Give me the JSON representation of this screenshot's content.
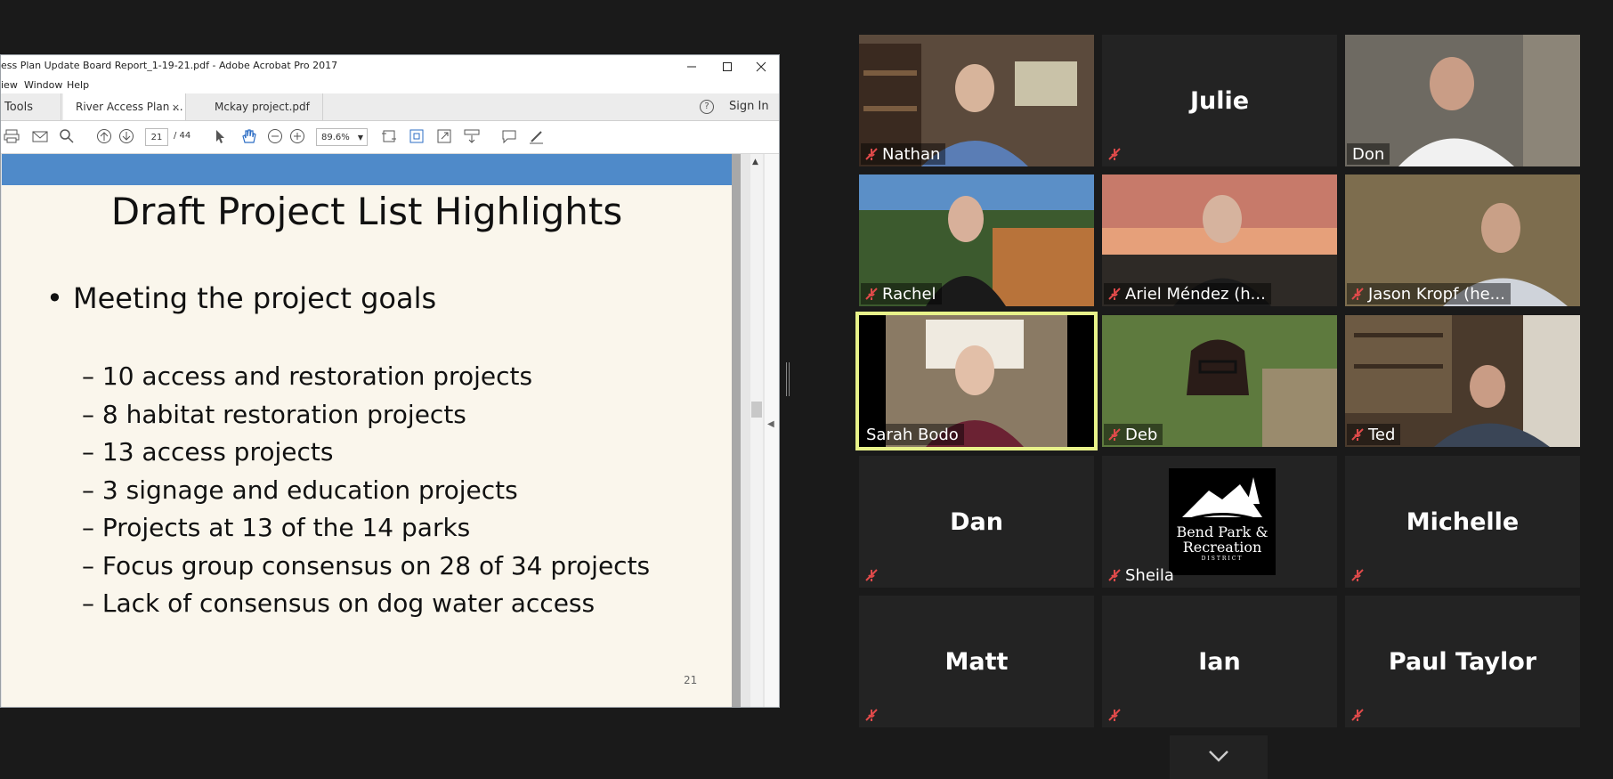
{
  "acrobat": {
    "window_title": "ess Plan Update Board Report_1-19-21.pdf - Adobe Acrobat Pro 2017",
    "menu": [
      "iew",
      "Window",
      "Help"
    ],
    "tabs": {
      "tools": "Tools",
      "active": "River Access Plan ...",
      "active_close": "×",
      "other": "Mckay project.pdf"
    },
    "signin": "Sign In",
    "help_glyph": "?",
    "page_current": "21",
    "page_total": "/ 44",
    "zoom": "89.6%"
  },
  "slide": {
    "title": "Draft Project List Highlights",
    "bullet": "Meeting the project goals",
    "subitems": [
      "– 10 access and restoration projects",
      "– 8 habitat restoration projects",
      "– 13 access projects",
      "– 3 signage and education projects",
      "– Projects at 13 of the 14 parks",
      "– Focus group consensus on 28 of 34 projects",
      "– Lack of consensus on dog water access"
    ],
    "page_number": "21"
  },
  "participants": [
    {
      "name": "Nathan",
      "muted": true,
      "video": true
    },
    {
      "name": "Julie",
      "muted": true,
      "video": false
    },
    {
      "name": "Don",
      "muted": false,
      "video": true
    },
    {
      "name": "Rachel",
      "muted": true,
      "video": true
    },
    {
      "name": "Ariel Méndez (h...",
      "muted": true,
      "video": true
    },
    {
      "name": "Jason Kropf (he...",
      "muted": true,
      "video": true
    },
    {
      "name": "Sarah Bodo",
      "muted": false,
      "video": true,
      "speaking": true
    },
    {
      "name": "Deb",
      "muted": true,
      "video": true
    },
    {
      "name": "Ted",
      "muted": true,
      "video": true
    },
    {
      "name": "Dan",
      "muted": true,
      "video": false
    },
    {
      "name": "Sheila",
      "muted": true,
      "video": false,
      "logo": true
    },
    {
      "name": "Michelle",
      "muted": true,
      "video": false
    },
    {
      "name": "Matt",
      "muted": true,
      "video": false
    },
    {
      "name": "Ian",
      "muted": true,
      "video": false
    },
    {
      "name": "Paul Taylor",
      "muted": true,
      "video": false
    }
  ],
  "logo_text": {
    "line1": "Bend Park &",
    "line2": "Recreation",
    "line3": "DISTRICT"
  },
  "colors": {
    "slide_band": "#4f8ac9",
    "speaking_highlight": "#e8f28a",
    "mute_icon": "#d9534f"
  }
}
